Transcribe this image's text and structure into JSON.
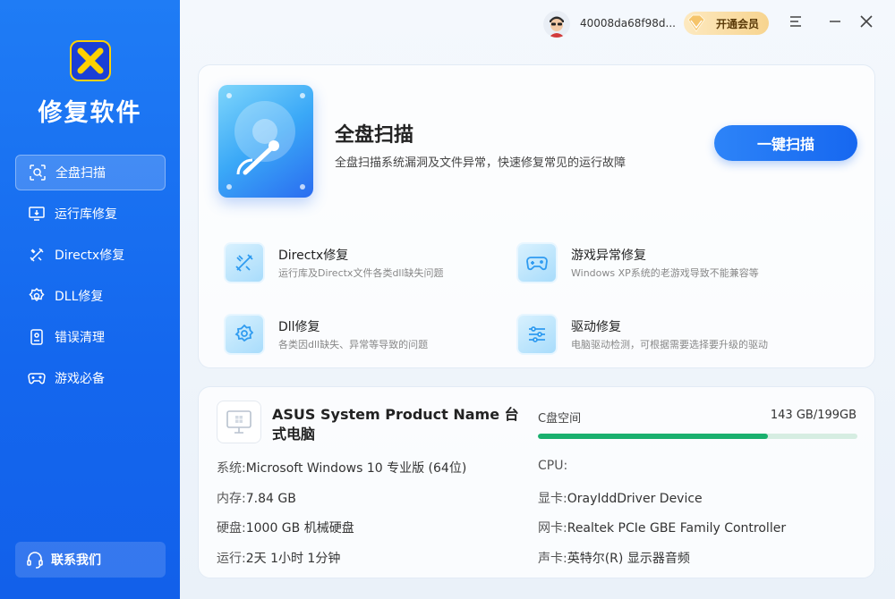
{
  "app": {
    "title": "修复软件"
  },
  "sidebar": {
    "items": [
      {
        "label": "全盘扫描",
        "icon": "scan-search-icon",
        "active": true
      },
      {
        "label": "运行库修复",
        "icon": "monitor-download-icon",
        "active": false
      },
      {
        "label": "Directx修复",
        "icon": "tools-icon",
        "active": false
      },
      {
        "label": "DLL修复",
        "icon": "gear-icon",
        "active": false
      },
      {
        "label": "错误清理",
        "icon": "clean-icon",
        "active": false
      },
      {
        "label": "游戏必备",
        "icon": "gamepad-icon",
        "active": false
      }
    ],
    "contact_label": "联系我们"
  },
  "topbar": {
    "username": "40008da68f98d...",
    "vip_label": "开通会员"
  },
  "hero": {
    "title": "全盘扫描",
    "description": "全盘扫描系统漏洞及文件异常，快速修复常见的运行故障",
    "button_label": "一键扫描"
  },
  "features": [
    {
      "title": "Directx修复",
      "desc": "运行库及Directx文件各类dll缺失问题",
      "icon": "tools-icon"
    },
    {
      "title": "游戏异常修复",
      "desc": "Windows XP系统的老游戏导致不能兼容等",
      "icon": "gamepad-icon"
    },
    {
      "title": "Dll修复",
      "desc": "各类因dll缺失、异常等导致的问题",
      "icon": "gear-icon"
    },
    {
      "title": "驱动修复",
      "desc": "电脑驱动检测，可根据需要选择要升级的驱动",
      "icon": "sliders-icon"
    }
  ],
  "system": {
    "name": "ASUS System Product Name 台式电脑",
    "left": [
      {
        "key": "系统:",
        "value": "Microsoft Windows 10 专业版 (64位)"
      },
      {
        "key": "内存:",
        "value": "7.84 GB"
      },
      {
        "key": "硬盘:",
        "value": "1000 GB 机械硬盘"
      },
      {
        "key": "运行:",
        "value": "2天 1小时 1分钟"
      }
    ],
    "right": [
      {
        "key": "CPU:",
        "value": ""
      },
      {
        "key": "显卡:",
        "value": "OrayIddDriver Device"
      },
      {
        "key": "网卡:",
        "value": "Realtek PCIe GBE Family Controller"
      },
      {
        "key": "声卡:",
        "value": "英特尔(R) 显示器音频"
      }
    ],
    "disk": {
      "label": "C盘空间",
      "value": "143 GB/199GB",
      "used_fraction": 0.72
    }
  },
  "colors": {
    "accent": "#1667f0",
    "disk_fill": "#1ab06e",
    "vip": "#f7d48f"
  }
}
